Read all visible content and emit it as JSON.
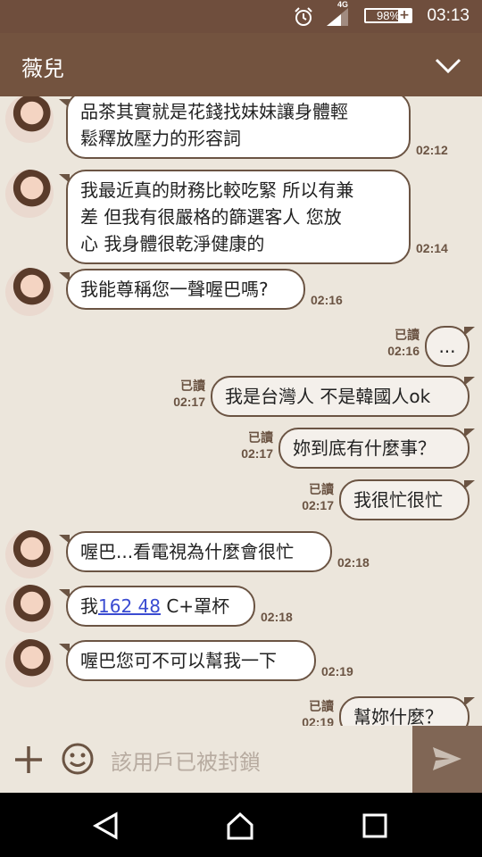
{
  "status": {
    "network": "4G",
    "battery": "98%",
    "battery_plus": "+",
    "time": "03:13"
  },
  "header": {
    "title": "薇兒"
  },
  "messages": [
    {
      "side": "left",
      "lines": [
        "品茶其實就是花錢找妹妹讓身體輕",
        "鬆釋放壓力的形容詞"
      ],
      "time": "02:12"
    },
    {
      "side": "left",
      "lines": [
        "我最近真的財務比較吃緊  所以有兼",
        "差  但我有很嚴格的篩選客人  您放",
        "心  我身體很乾淨健康的"
      ],
      "time": "02:14"
    },
    {
      "side": "left",
      "lines": [
        "我能尊稱您一聲喔巴嗎?"
      ],
      "time": "02:16"
    },
    {
      "side": "right",
      "text": "...",
      "read": "已讀",
      "time": "02:16"
    },
    {
      "side": "right",
      "text": "我是台灣人 不是韓國人ok",
      "read": "已讀",
      "time": "02:17"
    },
    {
      "side": "right",
      "text": "妳到底有什麼事？",
      "read": "已讀",
      "time": "02:17"
    },
    {
      "side": "right",
      "text": "我很忙很忙",
      "read": "已讀",
      "time": "02:17"
    },
    {
      "side": "left",
      "lines": [
        "喔巴...看電視為什麼會很忙"
      ],
      "time": "02:18"
    },
    {
      "side": "left",
      "prefix": "我",
      "link": "162  48",
      "suffix": " C+罩杯",
      "time": "02:18"
    },
    {
      "side": "left",
      "lines": [
        "喔巴您可不可以幫我一下"
      ],
      "time": "02:19"
    },
    {
      "side": "right",
      "text": "幫妳什麼？",
      "read": "已讀",
      "time": "02:19"
    }
  ],
  "input": {
    "placeholder": "該用戶已被封鎖"
  },
  "colors": {
    "header": "#73533f",
    "statusbar": "#6f4e3d",
    "background": "#ece6dc",
    "bubble_border": "#6b5443",
    "link": "#3a4bd1"
  }
}
